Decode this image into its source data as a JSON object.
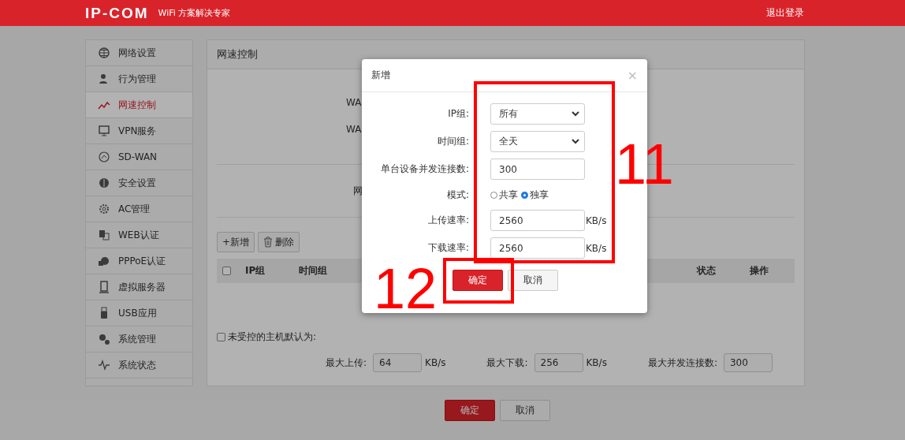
{
  "header": {
    "logo": "IP-COM",
    "tagline": "WiFi 方案解决专家",
    "logout": "退出登录"
  },
  "sidebar": {
    "items": [
      {
        "label": "网络设置",
        "selected": false
      },
      {
        "label": "行为管理",
        "selected": false
      },
      {
        "label": "网速控制",
        "selected": true
      },
      {
        "label": "VPN服务",
        "selected": false
      },
      {
        "label": "SD-WAN",
        "selected": false
      },
      {
        "label": "安全设置",
        "selected": false
      },
      {
        "label": "AC管理",
        "selected": false
      },
      {
        "label": "WEB认证",
        "selected": false
      },
      {
        "label": "PPPoE认证",
        "selected": false
      },
      {
        "label": "虚拟服务器",
        "selected": false
      },
      {
        "label": "USB应用",
        "selected": false
      },
      {
        "label": "系统管理",
        "selected": false
      },
      {
        "label": "系统状态",
        "selected": false
      }
    ]
  },
  "panel": {
    "title": "网速控制",
    "partial_labels": [
      "WA",
      "WA",
      "网"
    ],
    "toolbar": [
      {
        "kind": "add",
        "label": "+新增"
      },
      {
        "kind": "delete",
        "label": "删除"
      }
    ],
    "table": {
      "columns": [
        {
          "label": "IP组"
        },
        {
          "label": "时间组"
        },
        {
          "label": "状态"
        },
        {
          "label": "操作"
        }
      ],
      "select_all_checked": false
    },
    "default_host": {
      "label": "未受控的主机默认为:",
      "checked": false,
      "fields": [
        {
          "label": "最大上传:",
          "value": "64",
          "unit": "KB/s"
        },
        {
          "label": "最大下载:",
          "value": "256",
          "unit": "KB/s"
        },
        {
          "label": "最大并发连接数:",
          "value": "300"
        }
      ]
    }
  },
  "footer_buttons": [
    {
      "kind": "primary",
      "label": "确定"
    },
    {
      "kind": "secondary",
      "label": "取消"
    }
  ],
  "dialog": {
    "title": "新增",
    "close": "×",
    "rows": [
      {
        "kind": "select",
        "label": "IP组:",
        "value": "所有"
      },
      {
        "kind": "select",
        "label": "时间组:",
        "value": "全天"
      },
      {
        "kind": "input",
        "label": "单台设备并发连接数:",
        "value": "300"
      },
      {
        "kind": "radio",
        "label": "模式:",
        "options": [
          {
            "label": "共享",
            "selected": false
          },
          {
            "label": "独享",
            "selected": true
          }
        ]
      },
      {
        "kind": "input",
        "label": "上传速率:",
        "value": "2560",
        "unit": "KB/s"
      },
      {
        "kind": "input",
        "label": "下载速率:",
        "value": "2560",
        "unit": "KB/s"
      }
    ],
    "buttons": [
      {
        "kind": "primary",
        "label": "确定"
      },
      {
        "kind": "secondary",
        "label": "取消"
      }
    ]
  },
  "annotations": [
    {
      "kind": "fields",
      "number": "11"
    },
    {
      "kind": "confirm",
      "number": "12"
    }
  ]
}
